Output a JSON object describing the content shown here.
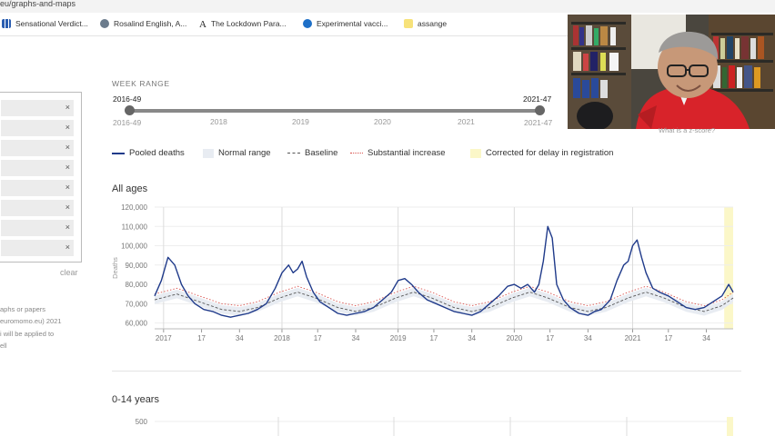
{
  "browser": {
    "url": "eu/graphs-and-maps",
    "bookmarks": [
      {
        "label": "Sensational Verdict...",
        "icon": "grid-icon"
      },
      {
        "label": "Rosalind English, A...",
        "icon": "globe-icon"
      },
      {
        "label": "The Lockdown Para...",
        "icon": "letter-a-icon"
      },
      {
        "label": "Experimental vacci...",
        "icon": "news-icon"
      },
      {
        "label": "assange",
        "icon": "folder-icon"
      }
    ]
  },
  "sidebar": {
    "remove_icon": "×",
    "filter_count": 8,
    "clear_label": "clear",
    "text_lines": [
      "aphs or papers",
      "euromomo.eu) 2021",
      "i will be applied to",
      "ell"
    ]
  },
  "week_range": {
    "heading": "WEEK RANGE",
    "start_label": "2016-49",
    "end_label": "2021-47",
    "start_bottom": "2016-49",
    "end_bottom": "2021-47",
    "year_ticks": [
      "2018",
      "2019",
      "2020",
      "2021"
    ],
    "selection": {
      "from": "2016-49",
      "to": "2021-47"
    }
  },
  "legend": {
    "pooled": "Pooled deaths",
    "normal": "Normal range",
    "baseline": "Baseline",
    "substantial": "Substantial increase",
    "corrected": "Corrected for delay in registration"
  },
  "overlay": {
    "zscore_link": "What is a z-score?"
  },
  "colors": {
    "pooled": "#1f3a8a",
    "baseline": "#555555",
    "substantial": "#d9534f",
    "normal_band": "#e8ecf2",
    "corrected": "#fbf7c8",
    "grid": "#dcdcdc"
  },
  "chart_data": [
    {
      "type": "line",
      "title": "All ages",
      "ylabel": "Deaths",
      "ylim": [
        57000,
        120000
      ],
      "yticks": [
        60000,
        70000,
        80000,
        90000,
        100000,
        110000,
        120000
      ],
      "ytick_labels": [
        "60,000",
        "70,000",
        "80,000",
        "90,000",
        "100,000",
        "110,000",
        "120,000"
      ],
      "xticks": [
        {
          "label": "2017",
          "week": 4,
          "year_start": true
        },
        {
          "label": "17",
          "week": 21
        },
        {
          "label": "34",
          "week": 38
        },
        {
          "label": "2018",
          "week": 57,
          "year_start": true
        },
        {
          "label": "17",
          "week": 73
        },
        {
          "label": "34",
          "week": 90
        },
        {
          "label": "2019",
          "week": 109,
          "year_start": true
        },
        {
          "label": "17",
          "week": 125
        },
        {
          "label": "34",
          "week": 142
        },
        {
          "label": "2020",
          "week": 161,
          "year_start": true
        },
        {
          "label": "17",
          "week": 177
        },
        {
          "label": "34",
          "week": 194
        },
        {
          "label": "2021",
          "week": 214,
          "year_start": true
        },
        {
          "label": "17",
          "week": 230
        },
        {
          "label": "34",
          "week": 247
        }
      ],
      "x_range": [
        0,
        259
      ],
      "corrected_from_week": 255,
      "series": [
        {
          "name": "Pooled deaths",
          "style": "solid",
          "points": [
            [
              0,
              74000
            ],
            [
              3,
              82000
            ],
            [
              6,
              94000
            ],
            [
              9,
              90000
            ],
            [
              12,
              80000
            ],
            [
              15,
              74000
            ],
            [
              18,
              70000
            ],
            [
              22,
              67000
            ],
            [
              26,
              66000
            ],
            [
              30,
              64000
            ],
            [
              34,
              63000
            ],
            [
              38,
              64000
            ],
            [
              42,
              65000
            ],
            [
              46,
              67000
            ],
            [
              50,
              70000
            ],
            [
              54,
              78000
            ],
            [
              57,
              86000
            ],
            [
              60,
              90000
            ],
            [
              62,
              86000
            ],
            [
              64,
              88000
            ],
            [
              66,
              92000
            ],
            [
              68,
              84000
            ],
            [
              71,
              76000
            ],
            [
              74,
              71000
            ],
            [
              78,
              68000
            ],
            [
              82,
              65000
            ],
            [
              86,
              64000
            ],
            [
              90,
              65000
            ],
            [
              94,
              66000
            ],
            [
              98,
              68000
            ],
            [
              102,
              72000
            ],
            [
              106,
              76000
            ],
            [
              109,
              82000
            ],
            [
              112,
              83000
            ],
            [
              115,
              80000
            ],
            [
              118,
              76000
            ],
            [
              122,
              72000
            ],
            [
              126,
              70000
            ],
            [
              130,
              68000
            ],
            [
              134,
              66000
            ],
            [
              138,
              65000
            ],
            [
              142,
              64000
            ],
            [
              146,
              66000
            ],
            [
              150,
              70000
            ],
            [
              154,
              74000
            ],
            [
              158,
              79000
            ],
            [
              161,
              80000
            ],
            [
              164,
              78000
            ],
            [
              167,
              80000
            ],
            [
              170,
              76000
            ],
            [
              172,
              80000
            ],
            [
              174,
              92000
            ],
            [
              176,
              110000
            ],
            [
              178,
              104000
            ],
            [
              180,
              80000
            ],
            [
              183,
              72000
            ],
            [
              186,
              68000
            ],
            [
              190,
              65000
            ],
            [
              194,
              64000
            ],
            [
              197,
              66000
            ],
            [
              200,
              67000
            ],
            [
              204,
              72000
            ],
            [
              207,
              82000
            ],
            [
              210,
              90000
            ],
            [
              212,
              92000
            ],
            [
              214,
              100000
            ],
            [
              216,
              103000
            ],
            [
              218,
              94000
            ],
            [
              220,
              86000
            ],
            [
              223,
              78000
            ],
            [
              226,
              76000
            ],
            [
              230,
              74000
            ],
            [
              234,
              71000
            ],
            [
              238,
              68000
            ],
            [
              242,
              67000
            ],
            [
              246,
              68000
            ],
            [
              250,
              71000
            ],
            [
              254,
              74000
            ],
            [
              257,
              80000
            ],
            [
              259,
              76000
            ]
          ]
        },
        {
          "name": "Baseline",
          "style": "dashed",
          "points": [
            [
              0,
              72000
            ],
            [
              10,
              75000
            ],
            [
              20,
              71000
            ],
            [
              30,
              67000
            ],
            [
              38,
              66000
            ],
            [
              46,
              68000
            ],
            [
              56,
              73000
            ],
            [
              64,
              76000
            ],
            [
              72,
              73000
            ],
            [
              82,
              68000
            ],
            [
              90,
              66000
            ],
            [
              98,
              68000
            ],
            [
              108,
              73000
            ],
            [
              116,
              76000
            ],
            [
              124,
              73000
            ],
            [
              134,
              68000
            ],
            [
              142,
              66000
            ],
            [
              150,
              68000
            ],
            [
              160,
              73000
            ],
            [
              168,
              76000
            ],
            [
              176,
              73000
            ],
            [
              186,
              68000
            ],
            [
              194,
              66000
            ],
            [
              202,
              68000
            ],
            [
              212,
              73000
            ],
            [
              220,
              76000
            ],
            [
              228,
              73000
            ],
            [
              238,
              68000
            ],
            [
              246,
              66000
            ],
            [
              254,
              69000
            ],
            [
              259,
              73000
            ]
          ]
        },
        {
          "name": "Substantial increase",
          "style": "dotted",
          "points": [
            [
              0,
              75000
            ],
            [
              10,
              78000
            ],
            [
              20,
              74000
            ],
            [
              30,
              70000
            ],
            [
              38,
              69000
            ],
            [
              46,
              71000
            ],
            [
              56,
              76000
            ],
            [
              64,
              79000
            ],
            [
              72,
              76000
            ],
            [
              82,
              71000
            ],
            [
              90,
              69000
            ],
            [
              98,
              71000
            ],
            [
              108,
              76000
            ],
            [
              116,
              79000
            ],
            [
              124,
              76000
            ],
            [
              134,
              71000
            ],
            [
              142,
              69000
            ],
            [
              150,
              71000
            ],
            [
              160,
              76000
            ],
            [
              168,
              79000
            ],
            [
              176,
              76000
            ],
            [
              186,
              71000
            ],
            [
              194,
              69000
            ],
            [
              202,
              71000
            ],
            [
              212,
              76000
            ],
            [
              220,
              79000
            ],
            [
              228,
              76000
            ],
            [
              238,
              71000
            ],
            [
              246,
              69000
            ],
            [
              254,
              72000
            ],
            [
              259,
              76000
            ]
          ]
        }
      ]
    },
    {
      "type": "line",
      "title": "0-14 years",
      "ylabel": "",
      "yticks": [
        500
      ],
      "ytick_labels": [
        "500"
      ],
      "series": []
    }
  ]
}
